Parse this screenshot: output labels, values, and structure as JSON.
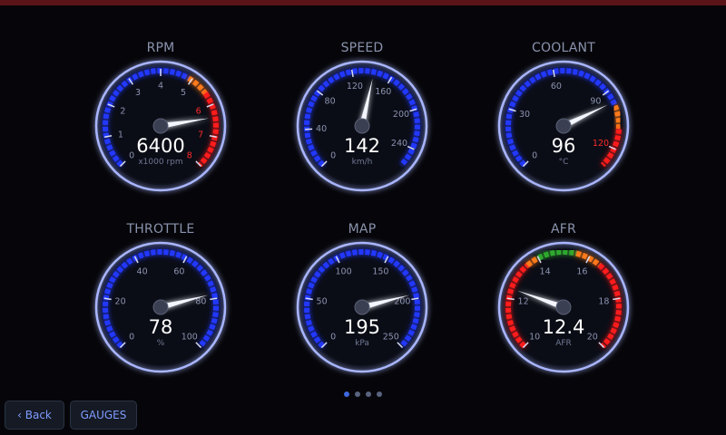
{
  "gauges": [
    {
      "id": "rpm",
      "title": "RPM",
      "value": "6400",
      "unit": "x1000 rpm",
      "min": 0,
      "max": 8,
      "current": 6.4,
      "ticks": [
        {
          "v": 0,
          "label": "0"
        },
        {
          "v": 1,
          "label": "1"
        },
        {
          "v": 2,
          "label": "2"
        },
        {
          "v": 3,
          "label": "3"
        },
        {
          "v": 4,
          "label": "4"
        },
        {
          "v": 5,
          "label": "5"
        },
        {
          "v": 6,
          "label": "6",
          "warn": true
        },
        {
          "v": 7,
          "label": "7",
          "warn": true
        },
        {
          "v": 8,
          "label": "8",
          "warn": true
        }
      ],
      "zones": [
        {
          "from": 0,
          "to": 4.9,
          "color": "#2238ff"
        },
        {
          "from": 4.9,
          "to": 5.6,
          "color": "#ff7a1a"
        },
        {
          "from": 5.6,
          "to": 8,
          "color": "#ff1a1a"
        }
      ]
    },
    {
      "id": "speed",
      "title": "SPEED",
      "value": "142",
      "unit": "km/h",
      "min": 0,
      "max": 260,
      "current": 142,
      "ticks": [
        {
          "v": 0,
          "label": "0"
        },
        {
          "v": 40,
          "label": "40"
        },
        {
          "v": 80,
          "label": "80"
        },
        {
          "v": 120,
          "label": "120"
        },
        {
          "v": 160,
          "label": "160"
        },
        {
          "v": 200,
          "label": "200"
        },
        {
          "v": 240,
          "label": "240"
        }
      ],
      "zones": [
        {
          "from": 0,
          "to": 260,
          "color": "#2238ff"
        }
      ]
    },
    {
      "id": "coolant",
      "title": "COOLANT",
      "value": "96",
      "unit": "°C",
      "min": 0,
      "max": 130,
      "current": 96,
      "ticks": [
        {
          "v": 0,
          "label": "0"
        },
        {
          "v": 30,
          "label": "30"
        },
        {
          "v": 60,
          "label": "60"
        },
        {
          "v": 90,
          "label": "90"
        },
        {
          "v": 120,
          "label": "120",
          "warn": true
        }
      ],
      "zones": [
        {
          "from": 0,
          "to": 98,
          "color": "#2238ff"
        },
        {
          "from": 98,
          "to": 110,
          "color": "#ff7a1a"
        },
        {
          "from": 110,
          "to": 130,
          "color": "#ff1a1a"
        }
      ]
    },
    {
      "id": "throttle",
      "title": "THROTTLE",
      "value": "78",
      "unit": "%",
      "min": 0,
      "max": 100,
      "current": 78,
      "ticks": [
        {
          "v": 0,
          "label": "0"
        },
        {
          "v": 20,
          "label": "20"
        },
        {
          "v": 40,
          "label": "40"
        },
        {
          "v": 60,
          "label": "60"
        },
        {
          "v": 80,
          "label": "80"
        },
        {
          "v": 100,
          "label": "100"
        }
      ],
      "zones": [
        {
          "from": 0,
          "to": 100,
          "color": "#2238ff"
        }
      ]
    },
    {
      "id": "map",
      "title": "MAP",
      "value": "195",
      "unit": "kPa",
      "min": 0,
      "max": 250,
      "current": 195,
      "ticks": [
        {
          "v": 0,
          "label": "0"
        },
        {
          "v": 50,
          "label": "50"
        },
        {
          "v": 100,
          "label": "100"
        },
        {
          "v": 150,
          "label": "150"
        },
        {
          "v": 200,
          "label": "200"
        },
        {
          "v": 250,
          "label": "250"
        }
      ],
      "zones": [
        {
          "from": 0,
          "to": 250,
          "color": "#2238ff"
        }
      ]
    },
    {
      "id": "afr",
      "title": "AFR",
      "value": "12.4",
      "unit": "AFR",
      "min": 10,
      "max": 20,
      "current": 12.4,
      "ticks": [
        {
          "v": 10,
          "label": "10"
        },
        {
          "v": 12,
          "label": "12"
        },
        {
          "v": 14,
          "label": "14"
        },
        {
          "v": 16,
          "label": "16"
        },
        {
          "v": 18,
          "label": "18"
        },
        {
          "v": 20,
          "label": "20"
        }
      ],
      "zones": [
        {
          "from": 10,
          "to": 13.5,
          "color": "#ff1a1a"
        },
        {
          "from": 13.5,
          "to": 14,
          "color": "#ff7a1a"
        },
        {
          "from": 14,
          "to": 15.5,
          "color": "#2ea82e"
        },
        {
          "from": 15.5,
          "to": 16.5,
          "color": "#ff7a1a"
        },
        {
          "from": 16.5,
          "to": 20,
          "color": "#ff1a1a"
        }
      ]
    }
  ],
  "pager": {
    "count": 4,
    "active": 0
  },
  "buttons": {
    "back": "‹ Back",
    "gauges": "GAUGES"
  },
  "colors": {
    "accent": "#3d68e0",
    "background": "#06060a",
    "topBar": "#5a1418"
  }
}
